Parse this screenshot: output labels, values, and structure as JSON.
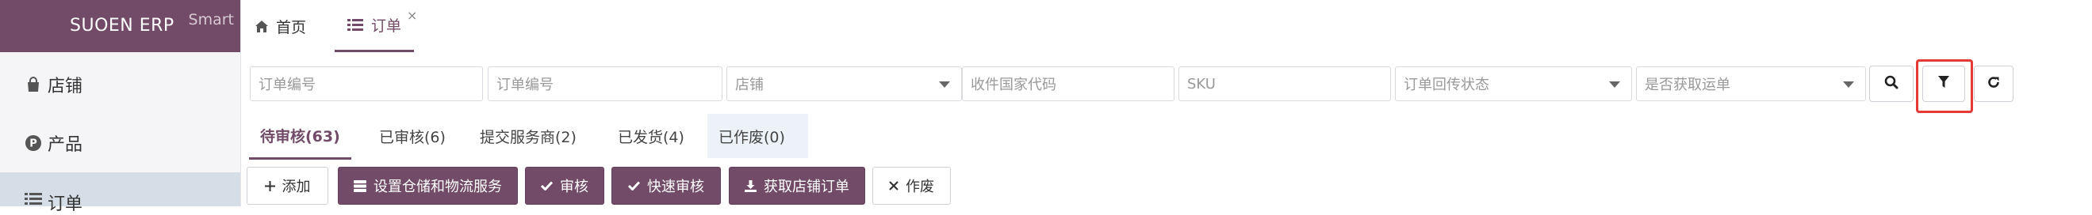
{
  "sidebar": {
    "brand": "SUOEN ERP",
    "brand_badge": "Smart",
    "items": [
      {
        "label": "店铺",
        "icon": "shopping-bag-icon"
      },
      {
        "label": "产品",
        "icon": "product-p-icon"
      },
      {
        "label": "订单",
        "icon": "list-icon",
        "active": true
      }
    ]
  },
  "top_tabs": [
    {
      "label": "首页",
      "icon": "home-icon"
    },
    {
      "label": "订单",
      "icon": "list-icon",
      "active": true,
      "close": "×"
    }
  ],
  "filters": {
    "order_no_1": "订单编号",
    "order_no_2": "订单编号",
    "store": "店铺",
    "country_code": "收件国家代码",
    "sku": "SKU",
    "callback_status": "订单回传状态",
    "waybill_obtained": "是否获取运单"
  },
  "status_tabs": [
    {
      "label": "待审核(63)",
      "active": true
    },
    {
      "label": "已审核(6)"
    },
    {
      "label": "提交服务商(2)"
    },
    {
      "label": "已发货(4)"
    },
    {
      "label": "已作废(0)"
    }
  ],
  "actions": {
    "add": "添加",
    "set_warehouse": "设置仓储和物流服务",
    "review": "审核",
    "quick_review": "快速审核",
    "fetch_orders": "获取店铺订单",
    "void": "作废"
  },
  "colors": {
    "brand": "#714b67",
    "highlight": "#e53935",
    "active_nav_bg": "#d5dde6"
  }
}
